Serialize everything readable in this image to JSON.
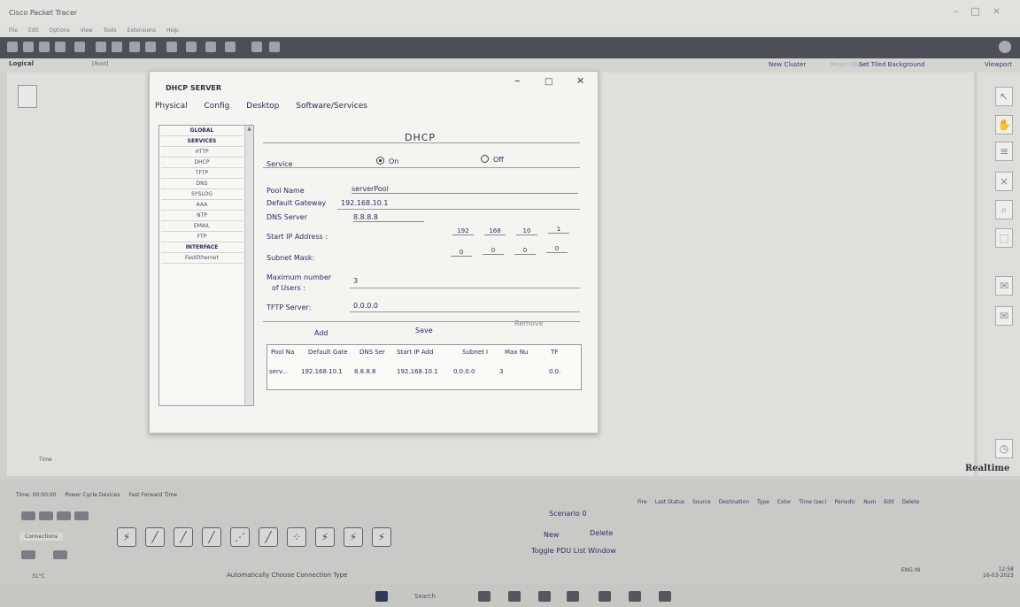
{
  "app": {
    "title": "Cisco Packet Tracer",
    "menu": [
      "File",
      "Edit",
      "Options",
      "View",
      "Tools",
      "Extensions",
      "Help"
    ]
  },
  "workspace": {
    "logical": "Logical",
    "root": "[Root]",
    "new_cluster": "New Cluster",
    "move_object": "Move Object",
    "set_tiled_background": "Set Tiled Background",
    "viewport": "Viewport",
    "realtime": "Realtime",
    "time_label": "Time"
  },
  "bottom": {
    "tabs": [
      "Time: 00:00:00",
      "Power Cycle Devices",
      "Fast Forward Time"
    ],
    "connections_label": "Connections",
    "connection_status": "Automatically Choose Connection Type",
    "scenario": "Scenario 0",
    "new": "New",
    "delete": "Delete",
    "toggle_pdu": "Toggle PDU List Window",
    "pdu_columns": [
      "Fire",
      "Last Status",
      "Source",
      "Destination",
      "Type",
      "Color",
      "Time (sec)",
      "Periodic",
      "Num",
      "Edit",
      "Delete"
    ]
  },
  "taskbar": {
    "weather": "31°C",
    "search": "Search",
    "lang": "ENG IN",
    "time": "12:58",
    "date": "16-03-2023"
  },
  "window": {
    "title": "DHCP SERVER",
    "tabs": [
      "Physical",
      "Config",
      "Desktop",
      "Software/Services"
    ],
    "services": [
      "GLOBAL",
      "SERVICES",
      "HTTP",
      "DHCP",
      "TFTP",
      "DNS",
      "SYSLOG",
      "AAA",
      "NTP",
      "EMAIL",
      "FTP",
      "INTERFACE",
      "FastEthernet"
    ]
  },
  "dhcp": {
    "heading": "DHCP",
    "service_label": "Service",
    "on_label": "On",
    "off_label": "Off",
    "service_on": true,
    "pool_name_label": "Pool Name",
    "pool_name": "serverPool",
    "gateway_label": "Default Gateway",
    "gateway": "192.168.10.1",
    "dns_label": "DNS Server",
    "dns": "8.8.8.8",
    "start_ip_label": "Start IP Address :",
    "start_ip": [
      "192",
      "168",
      "10",
      "1"
    ],
    "subnet_label": "Subnet Mask:",
    "subnet": [
      "0",
      "0",
      "0",
      "0"
    ],
    "max_users_label_1": "Maximum number",
    "max_users_label_2": "of Users :",
    "max_users": "3",
    "tftp_label": "TFTP Server:",
    "tftp": "0.0.0.0",
    "add": "Add",
    "save": "Save",
    "remove": "Remove",
    "table_headers": [
      "Pool Na",
      "Default Gate",
      "DNS Ser",
      "Start IP Add",
      "Subnet I",
      "Max Nu",
      "TF"
    ],
    "table_rows": [
      [
        "serv...",
        "192.168.10.1",
        "8.8.8.8",
        "192.168.10.1",
        "0.0.0.0",
        "3",
        "0.0."
      ]
    ]
  }
}
